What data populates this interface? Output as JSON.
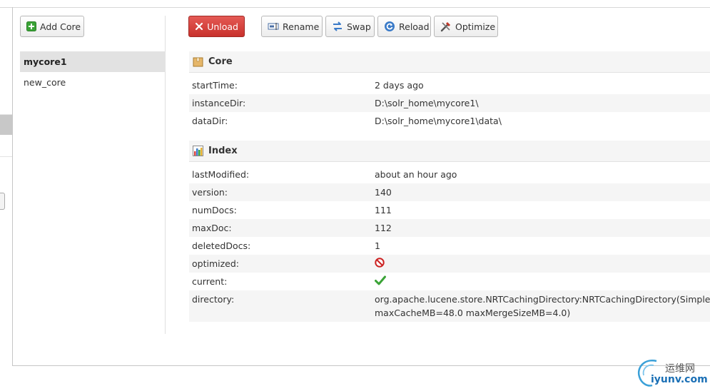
{
  "toolbar": {
    "add_core": "Add Core",
    "unload": "Unload",
    "rename": "Rename",
    "swap": "Swap",
    "reload": "Reload",
    "optimize": "Optimize"
  },
  "cores": [
    {
      "name": "mycore1",
      "selected": true
    },
    {
      "name": "new_core",
      "selected": false
    }
  ],
  "core_section": {
    "title": "Core",
    "icon": "package-icon",
    "rows": [
      {
        "key": "startTime:",
        "value": "2 days ago"
      },
      {
        "key": "instanceDir:",
        "value": "D:\\solr_home\\mycore1\\"
      },
      {
        "key": "dataDir:",
        "value": "D:\\solr_home\\mycore1\\data\\"
      }
    ]
  },
  "index_section": {
    "title": "Index",
    "icon": "bar-chart-icon",
    "rows": [
      {
        "key": "lastModified:",
        "value": "about an hour ago"
      },
      {
        "key": "version:",
        "value": "140"
      },
      {
        "key": "numDocs:",
        "value": "111"
      },
      {
        "key": "maxDoc:",
        "value": "112"
      },
      {
        "key": "deletedDocs:",
        "value": "1"
      },
      {
        "key": "optimized:",
        "value": "no-entry-icon"
      },
      {
        "key": "current:",
        "value": "checkmark-icon"
      },
      {
        "key": "directory:",
        "value": "org.apache.lucene.store.NRTCachingDirectory:NRTCachingDirectory(SimpleFSD",
        "value2": "maxCacheMB=48.0 maxMergeSizeMB=4.0)"
      }
    ]
  },
  "watermark": {
    "line1": "运维网",
    "line2": "iyunv.com"
  },
  "colors": {
    "unload_bg": "#d9423d",
    "selected_core_bg": "#e2e2e2",
    "row_alt_bg": "#f5f5f5",
    "check_green": "#3aa336",
    "no_red": "#cc2222"
  }
}
